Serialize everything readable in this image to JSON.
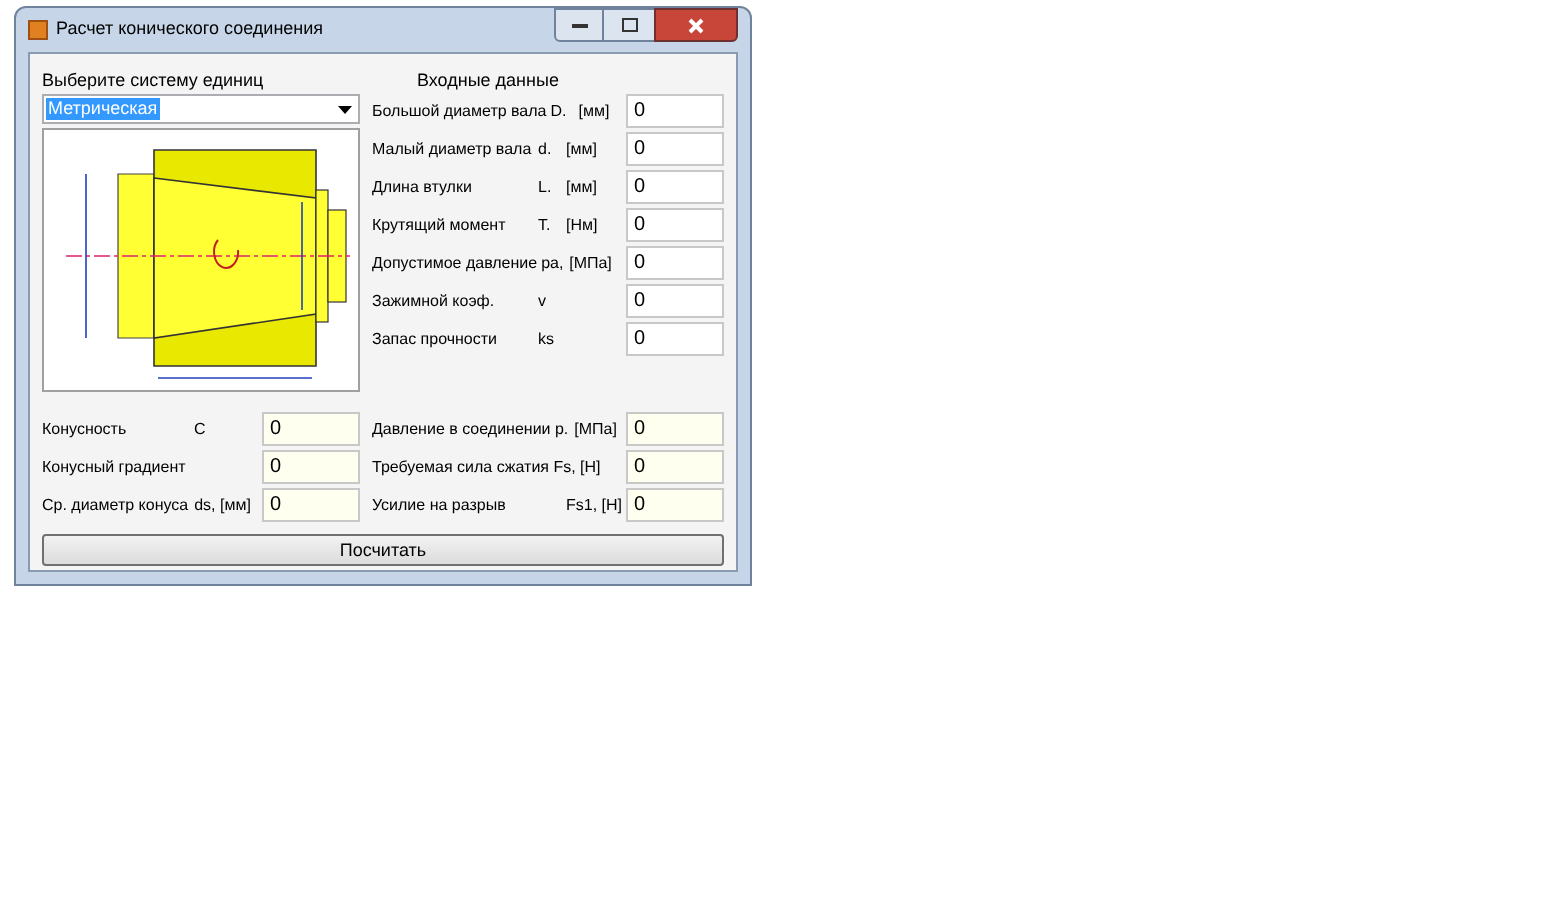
{
  "window": {
    "title": "Расчет конического соединения"
  },
  "units": {
    "label": "Выберите систему единиц",
    "value": "Метрическая"
  },
  "inputs_header": "Входные данные",
  "inputs": [
    {
      "label": "Большой диаметр вала",
      "symbol": "D.",
      "unit": "[мм]",
      "value": "0"
    },
    {
      "label": "Малый диаметр вала",
      "symbol": "d.",
      "unit": "[мм]",
      "value": "0"
    },
    {
      "label": "Длина втулки",
      "symbol": "L.",
      "unit": "[мм]",
      "value": "0"
    },
    {
      "label": "Крутящий момент",
      "symbol": "T.",
      "unit": "[Нм]",
      "value": "0"
    },
    {
      "label": "Допустимое давление",
      "symbol": "pa,",
      "unit": "[МПа]",
      "value": "0"
    },
    {
      "label": "Зажимной коэф.",
      "symbol": "v",
      "value": "0"
    },
    {
      "label": "Запас прочности",
      "symbol": "ks",
      "value": "0"
    }
  ],
  "outputs_left": [
    {
      "label": "Конусность",
      "symbol": "C",
      "value": "0"
    },
    {
      "label": "Конусный градиент",
      "value": "0"
    },
    {
      "label": "Ср. диаметр конуса",
      "symbol": "ds, [мм]",
      "value": "0"
    }
  ],
  "outputs_right": [
    {
      "label": "Давление в соединении p.",
      "symbol": "[МПа]",
      "value": "0"
    },
    {
      "label": "Требуемая сила сжатия Fs, [H]",
      "value": "0"
    },
    {
      "label": "Усилие на разрыв",
      "symbol": "Fs1, [H]",
      "value": "0"
    }
  ],
  "button": "Посчитать"
}
